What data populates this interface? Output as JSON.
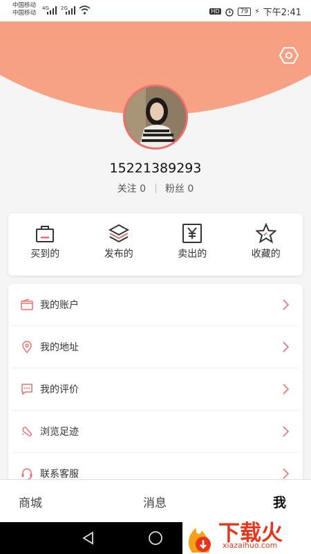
{
  "status_bar": {
    "carrier_1": "中国移动",
    "carrier_2": "中国移动",
    "net_1": "4G",
    "net_2": "2G",
    "hd": "HD",
    "battery": "79",
    "time": "下午2:41"
  },
  "profile": {
    "username": "15221389293",
    "follow_label": "关注",
    "follow_count": "0",
    "fans_label": "粉丝",
    "fans_count": "0"
  },
  "quick_actions": [
    {
      "label": "买到的",
      "icon": "shopping-bag-icon"
    },
    {
      "label": "发布的",
      "icon": "layers-icon"
    },
    {
      "label": "卖出的",
      "icon": "yen-box-icon"
    },
    {
      "label": "收藏的",
      "icon": "star-icon"
    }
  ],
  "menu": [
    {
      "label": "我的账户",
      "icon": "wallet-icon"
    },
    {
      "label": "我的地址",
      "icon": "location-pin-icon"
    },
    {
      "label": "我的评价",
      "icon": "comment-icon"
    },
    {
      "label": "浏览足迹",
      "icon": "footprint-icon"
    },
    {
      "label": "联系客服",
      "icon": "headset-icon"
    }
  ],
  "tabs": [
    {
      "label": "商城"
    },
    {
      "label": "消息"
    },
    {
      "label": "我",
      "active": true
    }
  ],
  "watermark": {
    "text": "下载火",
    "sub": "xiazaihuo.com"
  },
  "colors": {
    "accent": "#ee6f6f",
    "header_top": "#f6836d",
    "header_bottom": "#f7a385"
  }
}
